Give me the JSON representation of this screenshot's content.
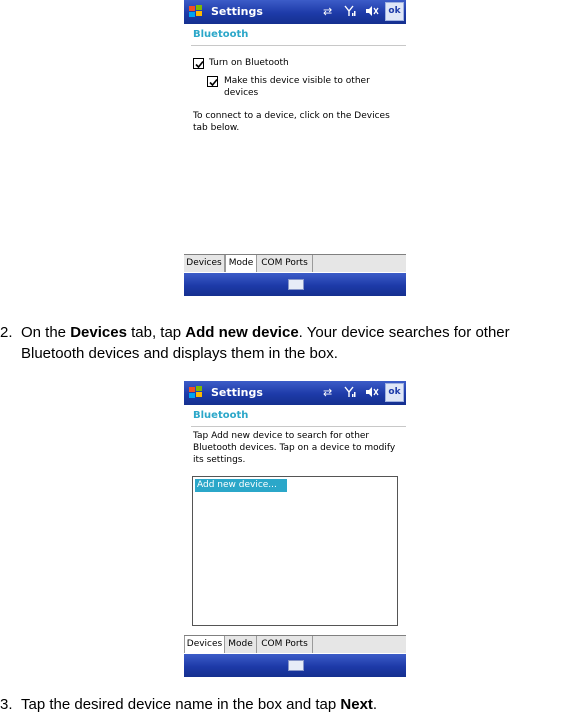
{
  "phone_top": {
    "title": "Settings",
    "ok": "ok",
    "section": "Bluetooth",
    "checkbox_1": "Turn on Bluetooth",
    "checkbox_2_line1": "Make this device visible to other",
    "checkbox_2_line2": "devices",
    "info_line1": "To connect to a device, click on the Devices",
    "info_line2": "tab below.",
    "tabs": [
      "Devices",
      "Mode",
      "COM Ports"
    ]
  },
  "step2": {
    "number": "2.",
    "t1": "On the ",
    "b1": "Devices",
    "t2": " tab, tap ",
    "b2": "Add new device",
    "t3": ". Your device searches for other",
    "line2": "Bluetooth devices and displays them in the box."
  },
  "phone_bottom": {
    "title": "Settings",
    "ok": "ok",
    "section": "Bluetooth",
    "info_line1": "Tap Add new device to search for other",
    "info_line2": "Bluetooth devices. Tap on a device to modify",
    "info_line3": "its settings.",
    "list_item": "Add new device...",
    "tabs": [
      "Devices",
      "Mode",
      "COM Ports"
    ]
  },
  "step3": {
    "number": "3.",
    "t1": "Tap the desired device name in the box and tap ",
    "b1": "Next",
    "t2": "."
  },
  "colors": {
    "titlebar_blue": "#1d3aa8",
    "section_cyan": "#2ba7c9"
  }
}
